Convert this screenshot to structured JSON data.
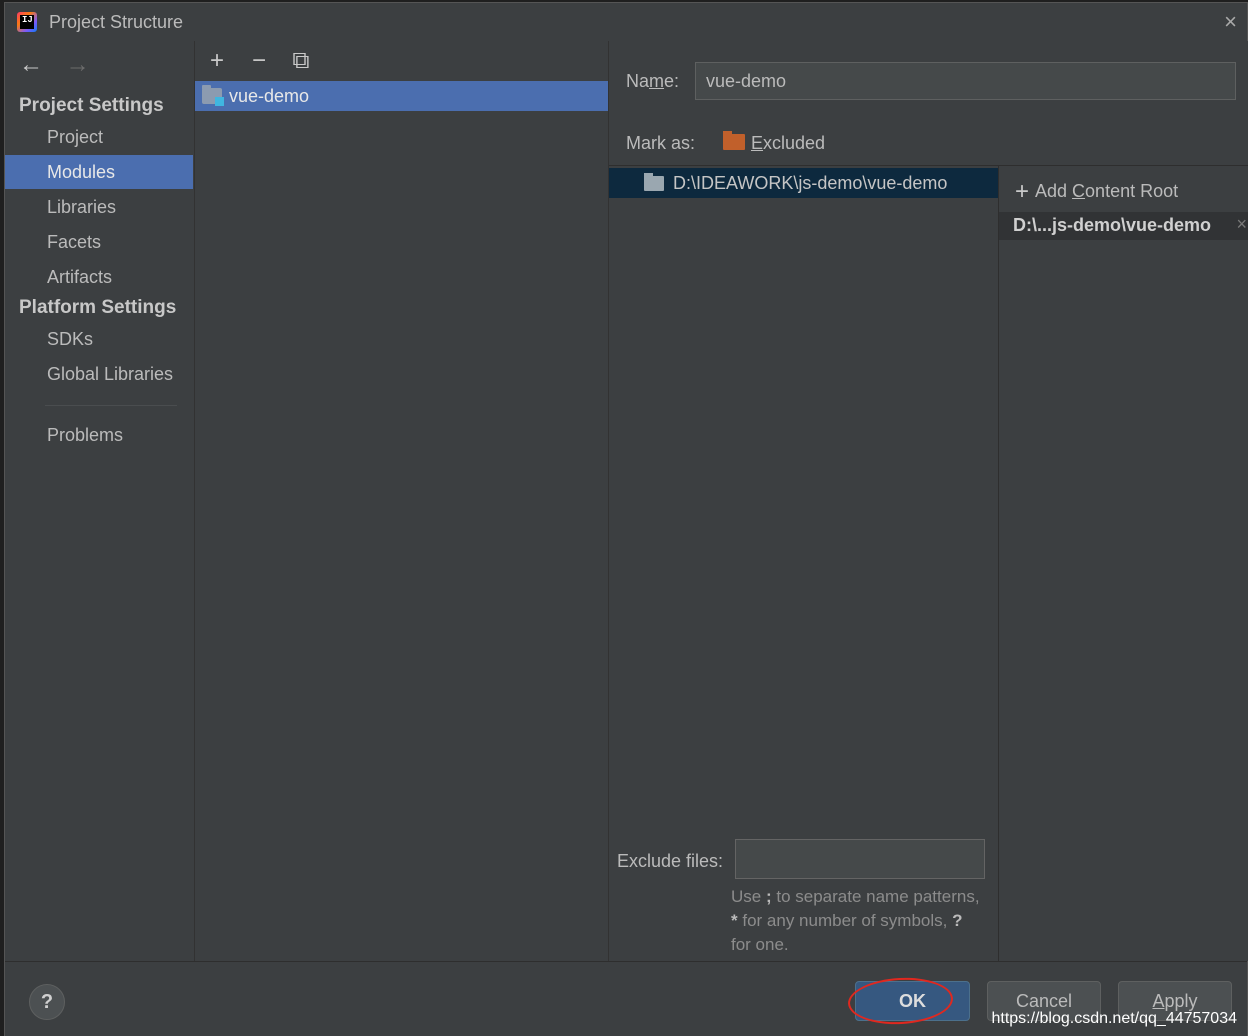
{
  "window": {
    "title": "Project Structure",
    "close_icon": "×"
  },
  "sidebar": {
    "back_icon": "←",
    "forward_icon": "→",
    "project_settings_title": "Project Settings",
    "platform_settings_title": "Platform Settings",
    "items": [
      {
        "label": "Project"
      },
      {
        "label": "Modules"
      },
      {
        "label": "Libraries"
      },
      {
        "label": "Facets"
      },
      {
        "label": "Artifacts"
      },
      {
        "label": "SDKs"
      },
      {
        "label": "Global Libraries"
      },
      {
        "label": "Problems"
      }
    ]
  },
  "modules": {
    "toolbar": {
      "add": "+",
      "remove": "−",
      "copy": "⧉"
    },
    "list": [
      {
        "label": "vue-demo"
      }
    ]
  },
  "details": {
    "name_label_pre": "Na",
    "name_label_u": "m",
    "name_label_post": "e:",
    "name_value": "vue-demo",
    "mark_as_label": "Mark as:",
    "excluded_u": "E",
    "excluded_rest": "xcluded",
    "tree_path": "D:\\IDEAWORK\\js-demo\\vue-demo",
    "add_root_pre": "Add ",
    "add_root_u": "C",
    "add_root_post": "ontent Root",
    "content_root": "D:\\...js-demo\\vue-demo",
    "remove_icon": "×",
    "exclude_files_label": "Exclude files:",
    "exclude_files_value": "",
    "hint_1": "Use ",
    "hint_semi": ";",
    "hint_2": " to separate name patterns, ",
    "hint_star": "*",
    "hint_3": " for any number of symbols, ",
    "hint_q": "?",
    "hint_4": " for one."
  },
  "footer": {
    "help": "?",
    "ok": "OK",
    "cancel": "Cancel",
    "apply_u": "A",
    "apply_rest": "pply",
    "watermark": "https://blog.csdn.net/qq_44757034"
  },
  "colors": {
    "background": "#3c3f41",
    "selection": "#4b6eaf",
    "tree_selection": "#0d293e",
    "excluded_folder": "#c1602b",
    "ok_button": "#365880",
    "annotation_circle": "#e0281f"
  }
}
